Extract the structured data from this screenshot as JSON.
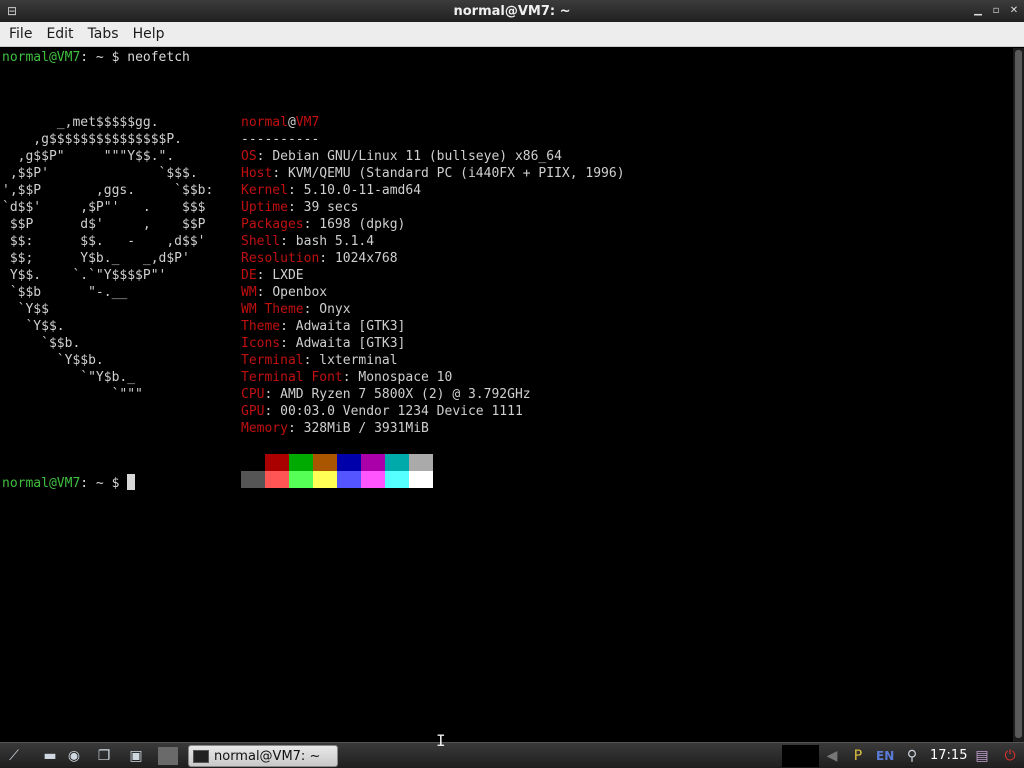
{
  "window": {
    "title": "normal@VM7: ~",
    "menu": [
      "File",
      "Edit",
      "Tabs",
      "Help"
    ]
  },
  "terminal": {
    "prompt_user": "normal@VM7",
    "prompt_rest": ": ~ $ ",
    "command": "neofetch",
    "final_prompt_user": "normal@VM7",
    "final_prompt_rest": ": ~ $ ",
    "art": [
      "       _,met$$$$$gg.",
      "    ,g$$$$$$$$$$$$$$$P.",
      "  ,g$$P\"     \"\"\"Y$$.\".",
      " ,$$P'              `$$$.",
      "',$$P       ,ggs.     `$$b:",
      "`d$$'     ,$P\"'   .    $$$",
      " $$P      d$'     ,    $$P",
      " $$:      $$.   -    ,d$$'",
      " $$;      Y$b._   _,d$P'",
      " Y$$.    `.`\"Y$$$$P\"'",
      " `$$b      \"-.__",
      "  `Y$$",
      "   `Y$$.",
      "     `$$b.",
      "       `Y$$b.",
      "          `\"Y$b._",
      "              `\"\"\""
    ],
    "info_header_user": "normal",
    "info_header_at": "@",
    "info_header_host": "VM7",
    "info_separator": "----------",
    "info": [
      {
        "key": "OS",
        "value": "Debian GNU/Linux 11 (bullseye) x86_64"
      },
      {
        "key": "Host",
        "value": "KVM/QEMU (Standard PC (i440FX + PIIX, 1996)"
      },
      {
        "key": "Kernel",
        "value": "5.10.0-11-amd64"
      },
      {
        "key": "Uptime",
        "value": "39 secs"
      },
      {
        "key": "Packages",
        "value": "1698 (dpkg)"
      },
      {
        "key": "Shell",
        "value": "bash 5.1.4"
      },
      {
        "key": "Resolution",
        "value": "1024x768"
      },
      {
        "key": "DE",
        "value": "LXDE"
      },
      {
        "key": "WM",
        "value": "Openbox"
      },
      {
        "key": "WM Theme",
        "value": "Onyx"
      },
      {
        "key": "Theme",
        "value": "Adwaita [GTK3]"
      },
      {
        "key": "Icons",
        "value": "Adwaita [GTK3]"
      },
      {
        "key": "Terminal",
        "value": "lxterminal"
      },
      {
        "key": "Terminal Font",
        "value": "Monospace 10"
      },
      {
        "key": "CPU",
        "value": "AMD Ryzen 7 5800X (2) @ 3.792GHz"
      },
      {
        "key": "GPU",
        "value": "00:03.0 Vendor 1234 Device 1111"
      },
      {
        "key": "Memory",
        "value": "328MiB / 3931MiB"
      }
    ],
    "palette_top": [
      "#000000",
      "#aa0000",
      "#00aa00",
      "#aa5500",
      "#0000aa",
      "#aa00aa",
      "#00aaaa",
      "#aaaaaa"
    ],
    "palette_bottom": [
      "#555555",
      "#ff5555",
      "#55ff55",
      "#ffff55",
      "#5555ff",
      "#ff55ff",
      "#55ffff",
      "#ffffff"
    ]
  },
  "taskbar": {
    "task_label": "normal@VM7: ~",
    "language": "EN",
    "clock": "17:15"
  }
}
